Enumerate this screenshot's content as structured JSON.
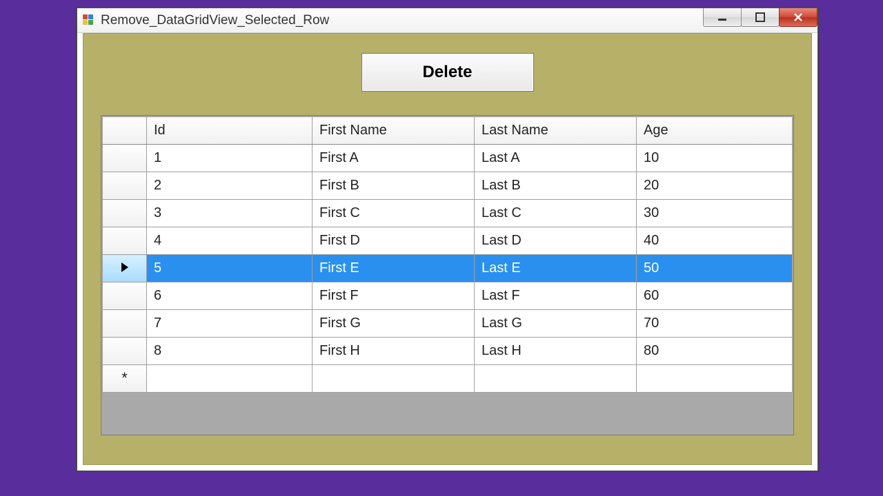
{
  "window": {
    "title": "Remove_DataGridView_Selected_Row"
  },
  "toolbar": {
    "delete_label": "Delete"
  },
  "grid": {
    "columns": [
      "Id",
      "First Name",
      "Last Name",
      "Age"
    ],
    "selected_index": 4,
    "new_row_marker": "*",
    "rows": [
      {
        "id": "1",
        "first": "First A",
        "last": "Last A",
        "age": "10"
      },
      {
        "id": "2",
        "first": "First B",
        "last": "Last B",
        "age": "20"
      },
      {
        "id": "3",
        "first": "First C",
        "last": "Last C",
        "age": "30"
      },
      {
        "id": "4",
        "first": "First D",
        "last": "Last D",
        "age": "40"
      },
      {
        "id": "5",
        "first": "First E",
        "last": "Last E",
        "age": "50"
      },
      {
        "id": "6",
        "first": "First F",
        "last": "Last F",
        "age": "60"
      },
      {
        "id": "7",
        "first": "First G",
        "last": "Last G",
        "age": "70"
      },
      {
        "id": "8",
        "first": "First H",
        "last": "Last H",
        "age": "80"
      }
    ]
  },
  "colors": {
    "form_bg": "#b7b069",
    "selection": "#2a90f0",
    "desktop": "#5a2d9c"
  }
}
